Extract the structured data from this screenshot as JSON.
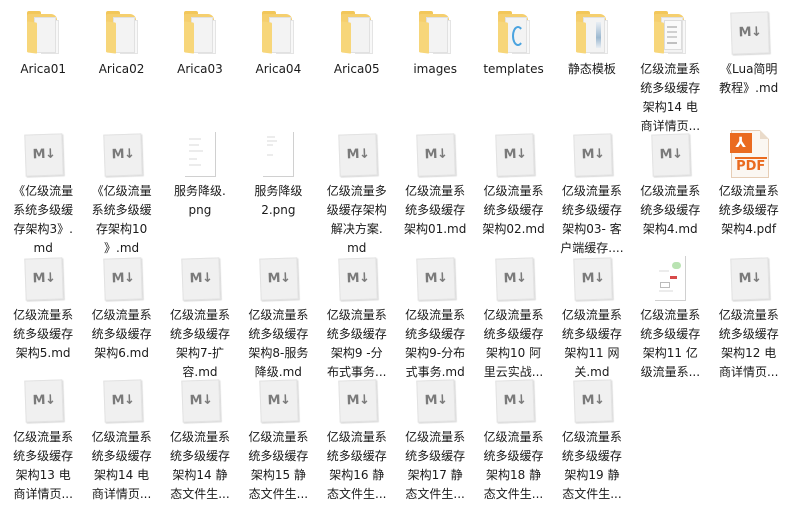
{
  "view": "file-explorer-large-icons",
  "rows": [
    [
      {
        "name": "Arica01",
        "type": "folder",
        "icon": "folder-icon",
        "lines": [
          "Arica01"
        ]
      },
      {
        "name": "Arica02",
        "type": "folder",
        "icon": "folder-icon",
        "lines": [
          "Arica02"
        ]
      },
      {
        "name": "Arica03",
        "type": "folder",
        "icon": "folder-icon",
        "lines": [
          "Arica03"
        ]
      },
      {
        "name": "Arica04",
        "type": "folder",
        "icon": "folder-icon",
        "lines": [
          "Arica04"
        ]
      },
      {
        "name": "Arica05",
        "type": "folder",
        "icon": "folder-icon",
        "lines": [
          "Arica05"
        ]
      },
      {
        "name": "images",
        "type": "folder",
        "icon": "folder-icon",
        "lines": [
          "images"
        ]
      },
      {
        "name": "templates",
        "type": "folder-blue",
        "icon": "folder-icon",
        "lines": [
          "templates"
        ]
      },
      {
        "name": "静态模板",
        "type": "folder-strip",
        "icon": "folder-icon",
        "lines": [
          "静态模板"
        ]
      },
      {
        "name": "亿级流量系统多级缓存架构14 电商详情页...",
        "type": "folder-doc",
        "icon": "folder-icon",
        "lines": [
          "亿级流量系",
          "统多级缓存",
          "架构14 电",
          "商详情页..."
        ]
      },
      {
        "name": "《Lua简明教程》.md",
        "type": "md",
        "icon": "markdown-file-icon",
        "lines": [
          "《Lua简明",
          "教程》.md"
        ]
      }
    ],
    [
      {
        "name": "《亿级流量系统多级缓存架构3》.md",
        "type": "md",
        "icon": "markdown-file-icon",
        "lines": [
          "《亿级流量",
          "系统多级缓",
          "存架构3》.",
          "md"
        ]
      },
      {
        "name": "《亿级流量系统多级缓存架构10》.md",
        "type": "md",
        "icon": "markdown-file-icon",
        "lines": [
          "《亿级流量",
          "系统多级缓",
          "存架构10",
          "》.md"
        ]
      },
      {
        "name": "服务降级.png",
        "type": "png",
        "icon": "image-thumbnail-icon",
        "lines": [
          "服务降级.",
          "png"
        ]
      },
      {
        "name": "服务降级2.png",
        "type": "png2",
        "icon": "image-thumbnail-icon",
        "lines": [
          "服务降级",
          "2.png"
        ]
      },
      {
        "name": "亿级流量多级缓存架构解决方案.md",
        "type": "md",
        "icon": "markdown-file-icon",
        "lines": [
          "亿级流量多",
          "级缓存架构",
          "解决方案.",
          "md"
        ]
      },
      {
        "name": "亿级流量系统多级缓存架构01.md",
        "type": "md",
        "icon": "markdown-file-icon",
        "lines": [
          "亿级流量系",
          "统多级缓存",
          "架构01.md"
        ]
      },
      {
        "name": "亿级流量系统多级缓存架构02.md",
        "type": "md",
        "icon": "markdown-file-icon",
        "lines": [
          "亿级流量系",
          "统多级缓存",
          "架构02.md"
        ]
      },
      {
        "name": "亿级流量系统多级缓存架构03- 客户端缓存....",
        "type": "md",
        "icon": "markdown-file-icon",
        "lines": [
          "亿级流量系",
          "统多级缓存",
          "架构03- 客",
          "户端缓存...."
        ]
      },
      {
        "name": "亿级流量系统多级缓存架构4.md",
        "type": "md",
        "icon": "markdown-file-icon",
        "lines": [
          "亿级流量系",
          "统多级缓存",
          "架构4.md"
        ]
      },
      {
        "name": "亿级流量系统多级缓存架构4.pdf",
        "type": "pdf",
        "icon": "pdf-file-icon",
        "lines": [
          "亿级流量系",
          "统多级缓存",
          "架构4.pdf"
        ]
      }
    ],
    [
      {
        "name": "亿级流量系统多级缓存架构5.md",
        "type": "md",
        "icon": "markdown-file-icon",
        "lines": [
          "亿级流量系",
          "统多级缓存",
          "架构5.md"
        ]
      },
      {
        "name": "亿级流量系统多级缓存架构6.md",
        "type": "md",
        "icon": "markdown-file-icon",
        "lines": [
          "亿级流量系",
          "统多级缓存",
          "架构6.md"
        ]
      },
      {
        "name": "亿级流量系统多级缓存架构7-扩容.md",
        "type": "md",
        "icon": "markdown-file-icon",
        "lines": [
          "亿级流量系",
          "统多级缓存",
          "架构7-扩",
          "容.md"
        ]
      },
      {
        "name": "亿级流量系统多级缓存架构8-服务降级.md",
        "type": "md",
        "icon": "markdown-file-icon",
        "lines": [
          "亿级流量系",
          "统多级缓存",
          "架构8-服务",
          "降级.md"
        ]
      },
      {
        "name": "亿级流量系统多级缓存架构9 -分布式事务...",
        "type": "md",
        "icon": "markdown-file-icon",
        "lines": [
          "亿级流量系",
          "统多级缓存",
          "架构9 -分",
          "布式事务..."
        ]
      },
      {
        "name": "亿级流量系统多级缓存架构9-分布式事务.md",
        "type": "md",
        "icon": "markdown-file-icon",
        "lines": [
          "亿级流量系",
          "统多级缓存",
          "架构9-分布",
          "式事务.md"
        ]
      },
      {
        "name": "亿级流量系统多级缓存架构10 阿里云实战...",
        "type": "md",
        "icon": "markdown-file-icon",
        "lines": [
          "亿级流量系",
          "统多级缓存",
          "架构10 阿",
          "里云实战..."
        ]
      },
      {
        "name": "亿级流量系统多级缓存架构11 网关.md",
        "type": "md",
        "icon": "markdown-file-icon",
        "lines": [
          "亿级流量系",
          "统多级缓存",
          "架构11 网",
          "关.md"
        ]
      },
      {
        "name": "亿级流量系统多级缓存架构11 亿级流量系...",
        "type": "diagram",
        "icon": "image-thumbnail-icon",
        "lines": [
          "亿级流量系",
          "统多级缓存",
          "架构11 亿",
          "级流量系..."
        ]
      },
      {
        "name": "亿级流量系统多级缓存架构12 电商详情页...",
        "type": "md",
        "icon": "markdown-file-icon",
        "lines": [
          "亿级流量系",
          "统多级缓存",
          "架构12 电",
          "商详情页..."
        ]
      }
    ],
    [
      {
        "name": "亿级流量系统多级缓存架构13 电商详情页...",
        "type": "md",
        "icon": "markdown-file-icon",
        "lines": [
          "亿级流量系",
          "统多级缓存",
          "架构13 电",
          "商详情页..."
        ]
      },
      {
        "name": "亿级流量系统多级缓存架构14 电商详情页...",
        "type": "md",
        "icon": "markdown-file-icon",
        "lines": [
          "亿级流量系",
          "统多级缓存",
          "架构14 电",
          "商详情页..."
        ]
      },
      {
        "name": "亿级流量系统多级缓存架构14 静态文件生...",
        "type": "md",
        "icon": "markdown-file-icon",
        "lines": [
          "亿级流量系",
          "统多级缓存",
          "架构14 静",
          "态文件生..."
        ]
      },
      {
        "name": "亿级流量系统多级缓存架构15 静态文件生...",
        "type": "md",
        "icon": "markdown-file-icon",
        "lines": [
          "亿级流量系",
          "统多级缓存",
          "架构15 静",
          "态文件生..."
        ]
      },
      {
        "name": "亿级流量系统多级缓存架构16 静态文件生...",
        "type": "md",
        "icon": "markdown-file-icon",
        "lines": [
          "亿级流量系",
          "统多级缓存",
          "架构16 静",
          "态文件生..."
        ]
      },
      {
        "name": "亿级流量系统多级缓存架构17 静态文件生...",
        "type": "md",
        "icon": "markdown-file-icon",
        "lines": [
          "亿级流量系",
          "统多级缓存",
          "架构17 静",
          "态文件生..."
        ]
      },
      {
        "name": "亿级流量系统多级缓存架构18 静态文件生...",
        "type": "md",
        "icon": "markdown-file-icon",
        "lines": [
          "亿级流量系",
          "统多级缓存",
          "架构18 静",
          "态文件生..."
        ]
      },
      {
        "name": "亿级流量系统多级缓存架构19 静态文件生...",
        "type": "md",
        "icon": "markdown-file-icon",
        "lines": [
          "亿级流量系",
          "统多级缓存",
          "架构19 静",
          "态文件生..."
        ]
      }
    ]
  ],
  "glyphs": {
    "md": "M↓",
    "pdf_logo": "⅄",
    "pdf_text": "PDF"
  },
  "colors": {
    "folder": "#f5cf6e",
    "pdf_accent": "#ea6b20",
    "md_glyph": "#7a7a7a"
  }
}
